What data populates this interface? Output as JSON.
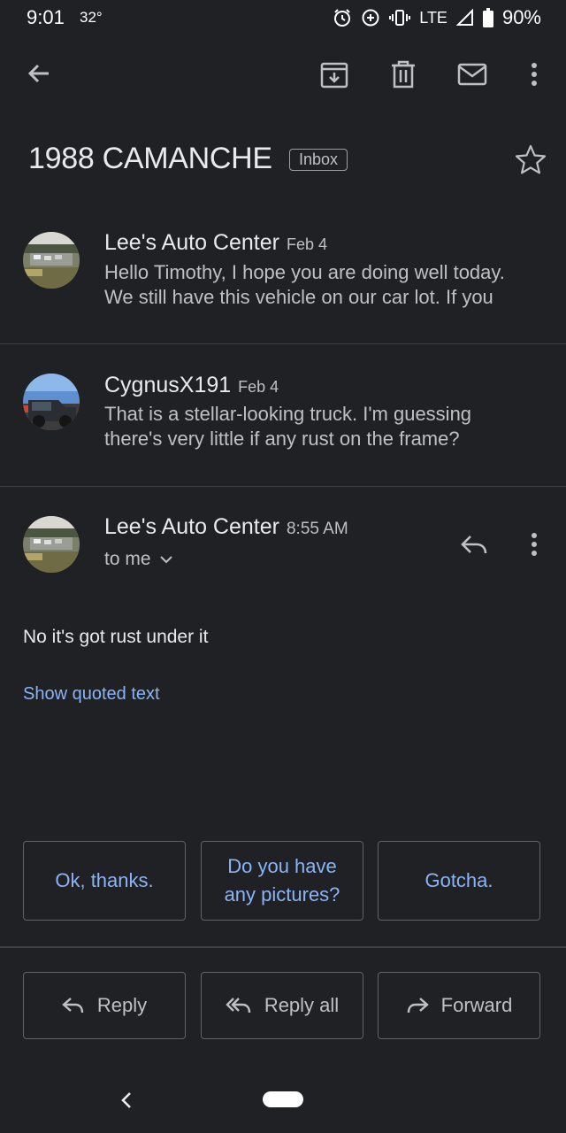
{
  "status_bar": {
    "time": "9:01",
    "temperature": "32°",
    "network": "LTE",
    "battery": "90%"
  },
  "toolbar": {
    "icons": [
      "back-arrow-icon",
      "archive-icon",
      "delete-icon",
      "mark-unread-icon",
      "more-vert-icon"
    ]
  },
  "email": {
    "subject": "1988 CAMANCHE",
    "label": "Inbox"
  },
  "messages": [
    {
      "sender": "Lee's Auto Center",
      "date": "Feb 4",
      "snippet_line1": "Hello Timothy, I hope you are doing well today.",
      "snippet_line2": "We still have this vehicle on our car lot. If you"
    },
    {
      "sender": "CygnusX191",
      "date": "Feb 4",
      "snippet_line1": "That is a stellar-looking truck. I'm guessing",
      "snippet_line2": "there's very little if any rust on the frame?"
    }
  ],
  "expanded_message": {
    "sender": "Lee's Auto Center",
    "time": "8:55 AM",
    "recipient": "to me",
    "body": "No it's got rust under it",
    "show_quoted": "Show quoted text"
  },
  "smart_replies": [
    {
      "line1": "Ok, thanks.",
      "line2": ""
    },
    {
      "line1": "Do you have",
      "line2": "any pictures?"
    },
    {
      "line1": "Gotcha.",
      "line2": ""
    }
  ],
  "actions": {
    "reply": "Reply",
    "reply_all": "Reply all",
    "forward": "Forward"
  },
  "colors": {
    "background": "#202124",
    "accent": "#8ab4f8",
    "text": "#e8eaed",
    "secondary": "#bdc1c6"
  }
}
